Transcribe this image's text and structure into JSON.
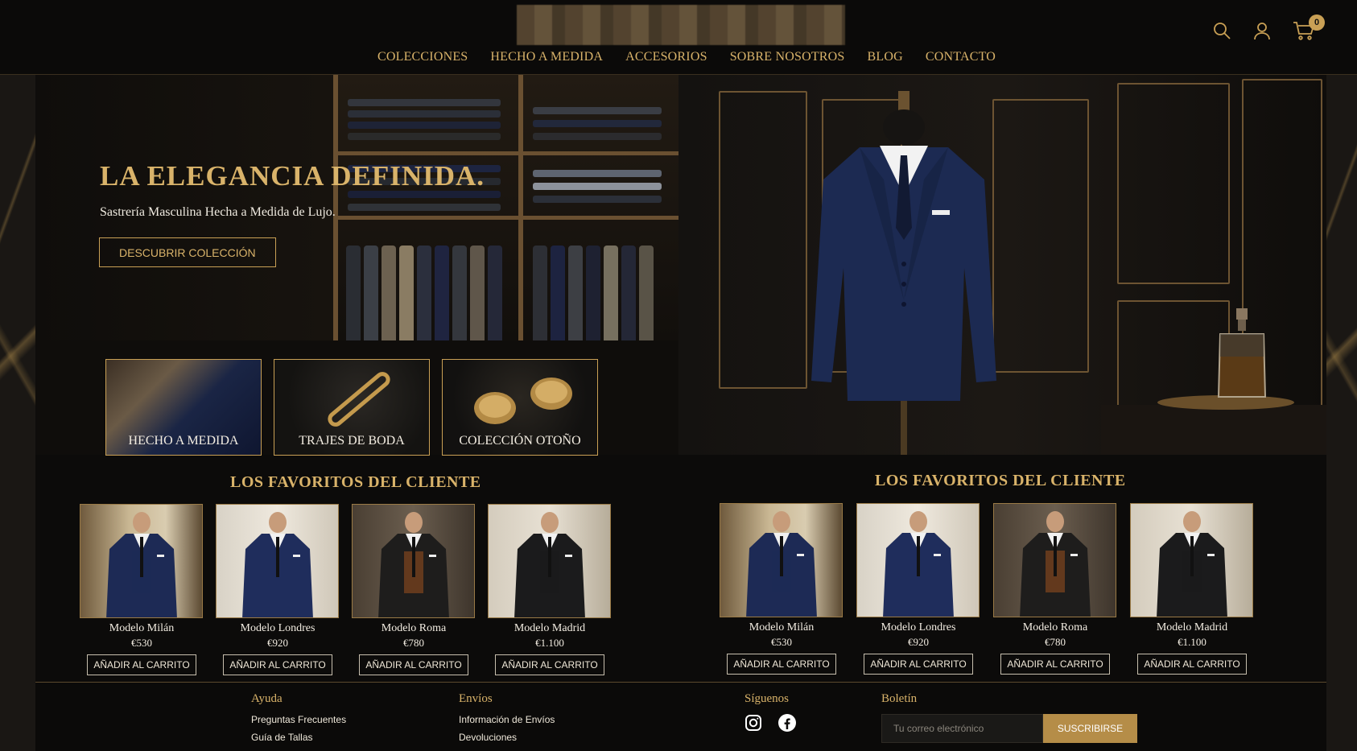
{
  "header": {
    "nav": [
      "COLECCIONES",
      "HECHO A MEDIDA",
      "ACCESORIOS",
      "SOBRE NOSOTROS",
      "BLOG",
      "CONTACTO"
    ],
    "icons": [
      "search-icon",
      "user-icon",
      "cart-icon"
    ],
    "cart_count": "0"
  },
  "hero": {
    "title": "LA ELEGANCIA DEFINIDA.",
    "subtitle": "Sastrería Masculina Hecha a Medida de Lujo.",
    "cta": "DESCUBRIR COLECCIÓN"
  },
  "categories": [
    "HECHO A MEDIDA",
    "TRAJES DE BODA",
    "COLECCIÓN OTOÑO"
  ],
  "favorites_left": {
    "title": "LOS FAVORITOS DEL CLIENTE",
    "products": [
      {
        "name": "Modelo Milán",
        "price": "€530",
        "button": "AÑADIR AL CARRITO"
      },
      {
        "name": "Modelo Londres",
        "price": "€920",
        "button": "AÑADIR AL CARRITO"
      },
      {
        "name": "Modelo Roma",
        "price": "€780",
        "button": "AÑADIR AL CARRITO"
      },
      {
        "name": "Modelo Madrid",
        "price": "€1.100",
        "button": "AÑADIR AL CARRITO"
      }
    ]
  },
  "favorites_right": {
    "title": "LOS FAVORITOS DEL CLIENTE",
    "products": [
      {
        "name": "Modelo Milán",
        "price": "€530",
        "button": "AÑADIR AL CARRITO"
      },
      {
        "name": "Modelo Londres",
        "price": "€920",
        "button": "AÑADIR AL CARRITO"
      },
      {
        "name": "Modelo Roma",
        "price": "€780",
        "button": "AÑADIR AL CARRITO"
      },
      {
        "name": "Modelo Madrid",
        "price": "€1.100",
        "button": "AÑADIR AL CARRITO"
      }
    ]
  },
  "footer": {
    "help": {
      "title": "Ayuda",
      "links": [
        "Preguntas Frecuentes",
        "Guía de Tallas"
      ]
    },
    "shipping": {
      "title": "Envíos",
      "links": [
        "Información de Envíos",
        "Devoluciones"
      ]
    },
    "social": {
      "title": "Síguenos",
      "icons": [
        "instagram-icon",
        "facebook-icon"
      ]
    },
    "newsletter": {
      "title": "Boletín",
      "placeholder": "Tu correo electrónico",
      "button": "SUSCRIBIRSE"
    }
  },
  "colors": {
    "gold": "#c9a055",
    "background": "#0c0b0a",
    "navy_suit": "#1c2a52",
    "cta_fill": "#b58d48"
  }
}
